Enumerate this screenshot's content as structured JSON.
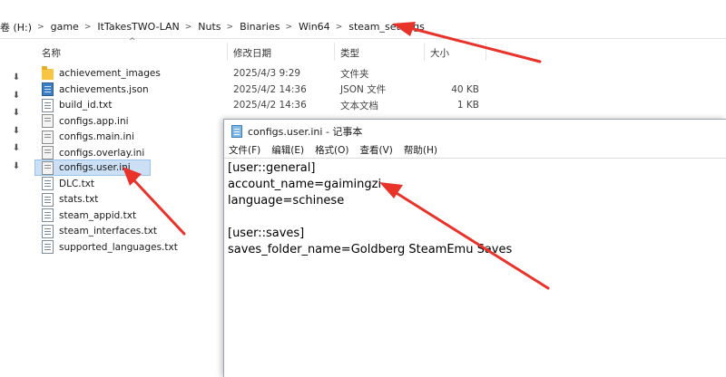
{
  "explorer": {
    "breadcrumbs": [
      "卷 (H:)",
      "game",
      "ItTakesTWO-LAN",
      "Nuts",
      "Binaries",
      "Win64",
      "steam_settings"
    ],
    "columns": {
      "name": "名称",
      "date": "修改日期",
      "type": "类型",
      "size": "大小"
    },
    "files": [
      {
        "name": "achievement_images",
        "date": "2025/4/3 9:29",
        "type": "文件夹",
        "size": "",
        "icon": "folder-icon"
      },
      {
        "name": "achievements.json",
        "date": "2025/4/2 14:36",
        "type": "JSON 文件",
        "size": "40 KB",
        "icon": "json-file-icon"
      },
      {
        "name": "build_id.txt",
        "date": "2025/4/2 14:36",
        "type": "文本文档",
        "size": "1 KB",
        "icon": "text-file-icon"
      },
      {
        "name": "configs.app.ini",
        "date": "",
        "type": "",
        "size": "",
        "icon": "ini-file-icon"
      },
      {
        "name": "configs.main.ini",
        "date": "",
        "type": "",
        "size": "",
        "icon": "ini-file-icon"
      },
      {
        "name": "configs.overlay.ini",
        "date": "",
        "type": "",
        "size": "",
        "icon": "ini-file-icon"
      },
      {
        "name": "configs.user.ini",
        "date": "",
        "type": "",
        "size": "",
        "icon": "ini-file-icon"
      },
      {
        "name": "DLC.txt",
        "date": "",
        "type": "",
        "size": "",
        "icon": "text-file-icon"
      },
      {
        "name": "stats.txt",
        "date": "",
        "type": "",
        "size": "",
        "icon": "text-file-icon"
      },
      {
        "name": "steam_appid.txt",
        "date": "",
        "type": "",
        "size": "",
        "icon": "text-file-icon"
      },
      {
        "name": "steam_interfaces.txt",
        "date": "",
        "type": "",
        "size": "",
        "icon": "text-file-icon"
      },
      {
        "name": "supported_languages.txt",
        "date": "",
        "type": "",
        "size": "",
        "icon": "text-file-icon"
      }
    ]
  },
  "notepad": {
    "title": "configs.user.ini - 记事本",
    "menu": [
      "文件(F)",
      "编辑(E)",
      "格式(O)",
      "查看(V)",
      "帮助(H)"
    ],
    "lines": [
      "[user::general]",
      "account_name=gaimingzi",
      "language=schinese",
      "",
      "[user::saves]",
      "saves_folder_name=Goldberg SteamEmu Saves"
    ]
  },
  "annotation_color": "#e8322a"
}
